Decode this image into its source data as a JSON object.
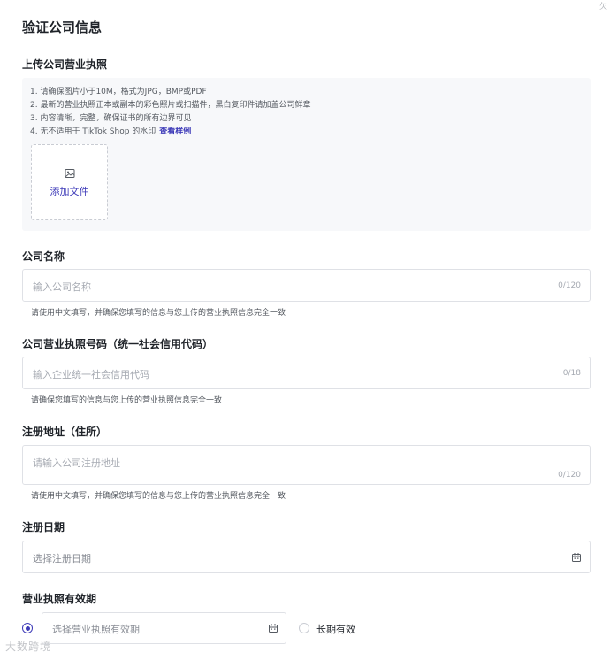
{
  "page": {
    "title": "验证公司信息"
  },
  "license_upload": {
    "label": "上传公司营业执照",
    "requirements": [
      "1. 请确保图片小于10M，格式为JPG，BMP或PDF",
      "2. 最新的营业执照正本或副本的彩色照片或扫描件，黑白复印件请加盖公司鲜章",
      "3. 内容清晰，完整，确保证书的所有边界可见",
      "4. 无不适用于 TikTok Shop 的水印"
    ],
    "example_link": "查看样例",
    "add_file": "添加文件",
    "icon": "image-icon"
  },
  "company_name": {
    "label": "公司名称",
    "placeholder": "输入公司名称",
    "counter": "0/120",
    "helper": "请使用中文填写，并确保您填写的信息与您上传的营业执照信息完全一致"
  },
  "license_number": {
    "label": "公司营业执照号码（统一社会信用代码）",
    "placeholder": "输入企业统一社会信用代码",
    "counter": "0/18",
    "helper": "请确保您填写的信息与您上传的营业执照信息完全一致"
  },
  "registered_address": {
    "label": "注册地址（住所）",
    "placeholder": "请输入公司注册地址",
    "counter": "0/120",
    "helper": "请使用中文填写，并确保您填写的信息与您上传的营业执照信息完全一致"
  },
  "registration_date": {
    "label": "注册日期",
    "placeholder": "选择注册日期",
    "icon": "calendar-icon"
  },
  "license_validity": {
    "label": "营业执照有效期",
    "date_placeholder": "选择营业执照有效期",
    "long_term_label": "长期有效",
    "selected_option": "date",
    "icon": "calendar-icon"
  },
  "watermark": {
    "text": "大数跨境"
  },
  "corner_mark": {
    "text": "欠"
  },
  "colors": {
    "accent": "#3d3ab8",
    "panel_bg": "#f7f8fa",
    "border": "#dfe1e6",
    "placeholder": "#a6aab2"
  }
}
